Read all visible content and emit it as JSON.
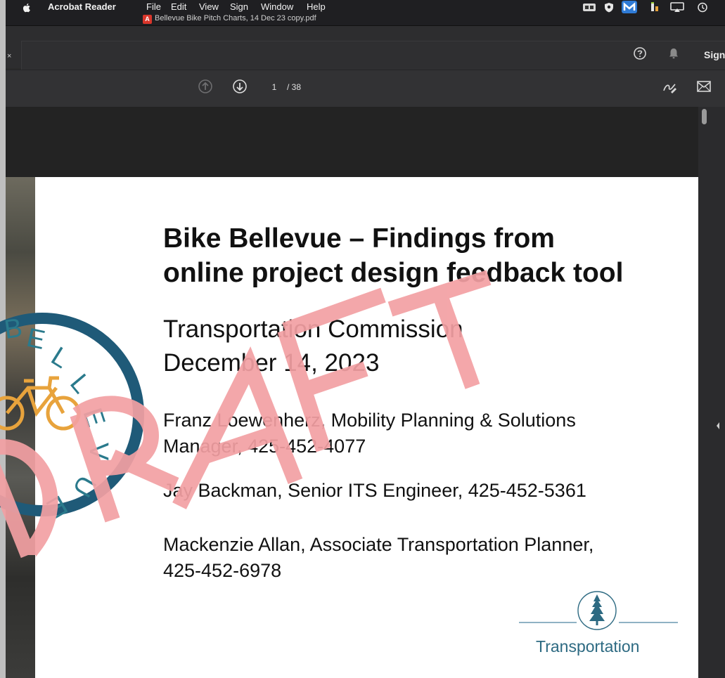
{
  "menubar": {
    "app_name": "Acrobat Reader",
    "items": [
      "File",
      "Edit",
      "View",
      "Sign",
      "Window",
      "Help"
    ]
  },
  "document": {
    "file_name": "Bellevue Bike Pitch Charts, 14 Dec 23 copy.pdf"
  },
  "tabbar": {
    "close_glyph": "×",
    "sign_label": "Sign"
  },
  "toolbar": {
    "current_page": "1",
    "total_pages": "/ 38"
  },
  "slide": {
    "title_line1": "Bike Bellevue – Findings from",
    "title_line2": "online project design feedback tool",
    "subtitle_line1": "Transportation Commission",
    "subtitle_line2": "December 14, 2023",
    "presenters": [
      {
        "line1": "Franz Loewenherz, Mobility Planning & Solutions",
        "line2": "Manager, 425-452-4077"
      },
      {
        "line1": "Jay Backman, Senior ITS Engineer, 425-452-5361"
      },
      {
        "line1": "Mackenzie Allan, Associate Transportation Planner,",
        "line2": "425-452-6978"
      }
    ],
    "footer_label": "Transportation",
    "watermark": "DRAFT",
    "badge_text": "BELLEVUE"
  },
  "colors": {
    "menubar_bg": "#1f1f22",
    "toolbar_bg": "#323234",
    "draft_pink": "#f3a0a3",
    "badge_blue": "#1f5a78",
    "bike_orange": "#e8a33c",
    "transport_teal": "#2d6a82"
  },
  "icons": {
    "apple": "apple-icon",
    "pdf": "pdf-file-icon",
    "help": "help-circle-icon",
    "bell": "bell-icon",
    "prev": "arrow-up-circle-icon",
    "next": "arrow-down-circle-icon",
    "sign": "pen-sign-icon",
    "mail": "mail-icon"
  }
}
